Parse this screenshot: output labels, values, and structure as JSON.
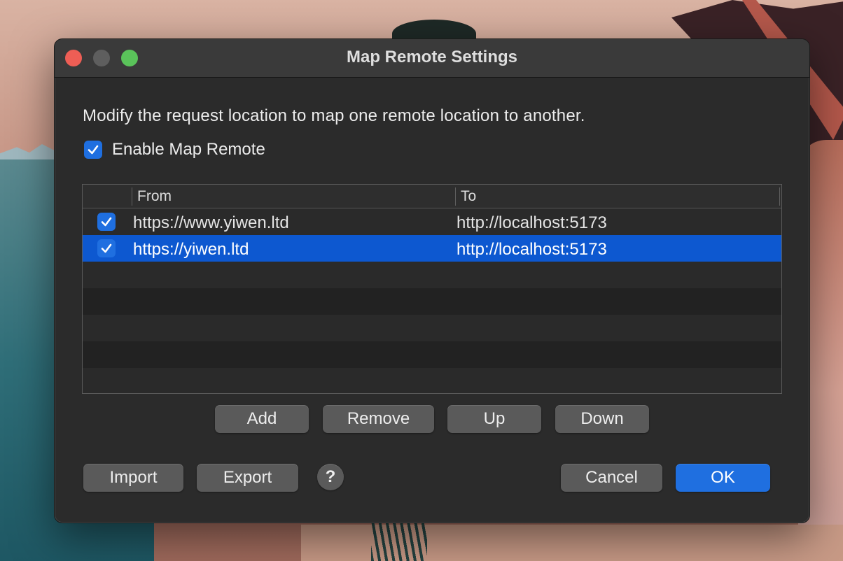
{
  "window": {
    "title": "Map Remote Settings"
  },
  "description": "Modify the request location to map one remote location to another.",
  "enable": {
    "label": "Enable Map Remote",
    "checked": true
  },
  "table": {
    "columns": [
      "",
      "From",
      "To"
    ],
    "rows": [
      {
        "enabled": true,
        "from": "https://www.yiwen.ltd",
        "to": "http://localhost:5173",
        "selected": false
      },
      {
        "enabled": true,
        "from": "https://yiwen.ltd",
        "to": "http://localhost:5173",
        "selected": true
      }
    ]
  },
  "row_buttons": {
    "add": "Add",
    "remove": "Remove",
    "up": "Up",
    "down": "Down"
  },
  "footer": {
    "import": "Import",
    "export": "Export",
    "help": "?",
    "cancel": "Cancel",
    "ok": "OK"
  },
  "colors": {
    "accent": "#1f6fe0",
    "selection": "#0d58d0",
    "close": "#ee5e55",
    "maximize": "#5ac35a"
  }
}
